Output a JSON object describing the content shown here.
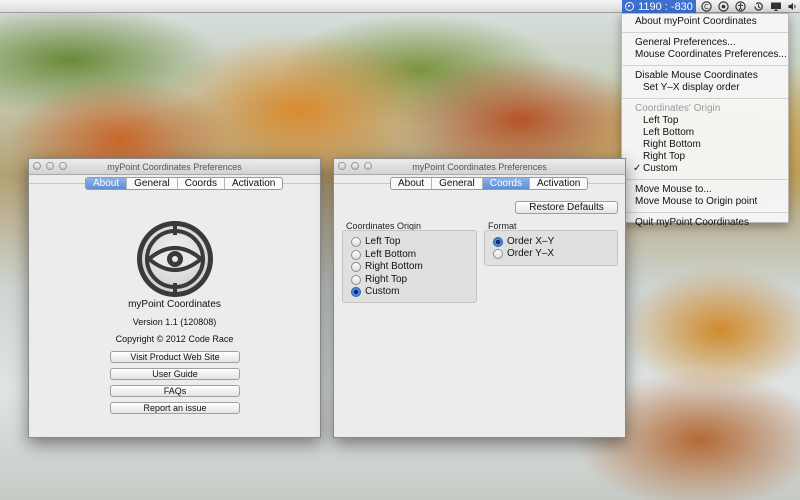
{
  "menubar": {
    "coords_readout": "1190 : -830",
    "tray_icons": [
      "mypoint-coords-icon",
      "copyright-c-icon",
      "target-icon",
      "accessibility-icon",
      "time-machine-icon",
      "display-icon",
      "volume-icon"
    ]
  },
  "dropdown": {
    "items": [
      {
        "label": "About myPoint Coordinates"
      },
      {
        "label": "General Preferences..."
      },
      {
        "label": "Mouse Coordinates Preferences..."
      },
      {
        "label": "Disable Mouse Coordinates"
      },
      {
        "label": "Set Y–X display order"
      },
      {
        "label": "Coordinates' Origin"
      },
      {
        "label": "Left Top"
      },
      {
        "label": "Left Bottom"
      },
      {
        "label": "Right Bottom"
      },
      {
        "label": "Right Top"
      },
      {
        "label": "Custom"
      },
      {
        "label": "Move Mouse to..."
      },
      {
        "label": "Move Mouse to Origin point"
      },
      {
        "label": "Quit myPoint Coordinates"
      }
    ]
  },
  "about_window": {
    "title": "myPoint Coordinates Preferences",
    "tabs": [
      "About",
      "General",
      "Coords",
      "Activation"
    ],
    "active_tab": "About",
    "app_name": "myPoint Coordinates",
    "version": "Version 1.1 (120808)",
    "copyright": "Copyright © 2012 Code Race",
    "buttons": [
      "Visit Product Web Site",
      "User Guide",
      "FAQs",
      "Report an issue"
    ]
  },
  "coords_window": {
    "title": "myPoint Coordinates Preferences",
    "tabs": [
      "About",
      "General",
      "Coords",
      "Activation"
    ],
    "active_tab": "Coords",
    "restore_button": "Restore Defaults",
    "origin_label": "Coordinates Origin",
    "origin_options": [
      "Left Top",
      "Left Bottom",
      "Right Bottom",
      "Right Top",
      "Custom"
    ],
    "origin_selected": "Custom",
    "format_label": "Format",
    "format_options": [
      "Order X–Y",
      "Order Y–X"
    ],
    "format_selected": "Order X–Y"
  },
  "colors": {
    "accent": "#3d71cf",
    "tab_active": "#5f8dd6"
  }
}
